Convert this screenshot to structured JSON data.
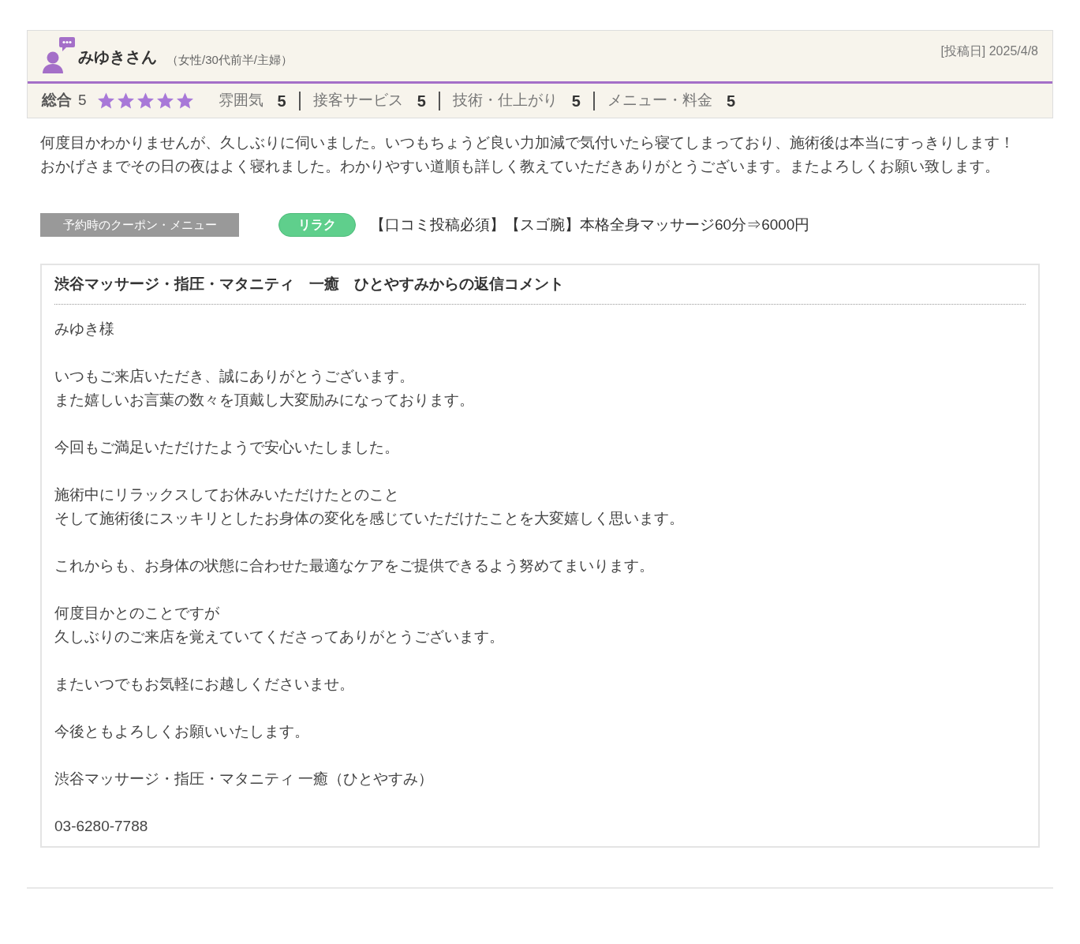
{
  "review": {
    "reviewer": "みゆきさん",
    "profile": "（女性/30代前半/主婦）",
    "posted": "[投稿日] 2025/4/8",
    "overall": {
      "label": "総合",
      "score": "5",
      "stars": 5
    },
    "ratings": [
      {
        "label": "雰囲気",
        "score": "5"
      },
      {
        "label": "接客サービス",
        "score": "5"
      },
      {
        "label": "技術・仕上がり",
        "score": "5"
      },
      {
        "label": "メニュー・料金",
        "score": "5"
      }
    ],
    "body": [
      "何度目かわかりませんが、久しぶりに伺いました。いつもちょうど良い力加減で気付いたら寝てしまっており、施術後は本当にすっきりします！",
      "おかげさまでその日の夜はよく寝れました。わかりやすい道順も詳しく教えていただきありがとうございます。またよろしくお願い致します。"
    ],
    "coupon": {
      "label": "予約時のクーポン・メニュー",
      "tag": "リラク",
      "name": "【口コミ投稿必須】【スゴ腕】本格全身マッサージ60分⇒6000円"
    },
    "reply": {
      "title": "渋谷マッサージ・指圧・マタニティ　一癒　ひとやすみからの返信コメント",
      "paragraphs": [
        [
          "みゆき様"
        ],
        [
          "いつもご来店いただき、誠にありがとうございます。",
          "また嬉しいお言葉の数々を頂戴し大変励みになっております。"
        ],
        [
          "今回もご満足いただけたようで安心いたしました。"
        ],
        [
          "施術中にリラックスしてお休みいただけたとのこと",
          "そして施術後にスッキリとしたお身体の変化を感じていただけたことを大変嬉しく思います。"
        ],
        [
          "これからも、お身体の状態に合わせた最適なケアをご提供できるよう努めてまいります。"
        ],
        [
          "何度目かとのことですが",
          "久しぶりのご来店を覚えていてくださってありがとうございます。"
        ],
        [
          "またいつでもお気軽にお越しくださいませ。"
        ],
        [
          "今後ともよろしくお願いいたします。"
        ],
        [
          "渋谷マッサージ・指圧・マタニティ 一癒（ひとやすみ）"
        ],
        [
          "03-6280-7788"
        ]
      ]
    }
  }
}
